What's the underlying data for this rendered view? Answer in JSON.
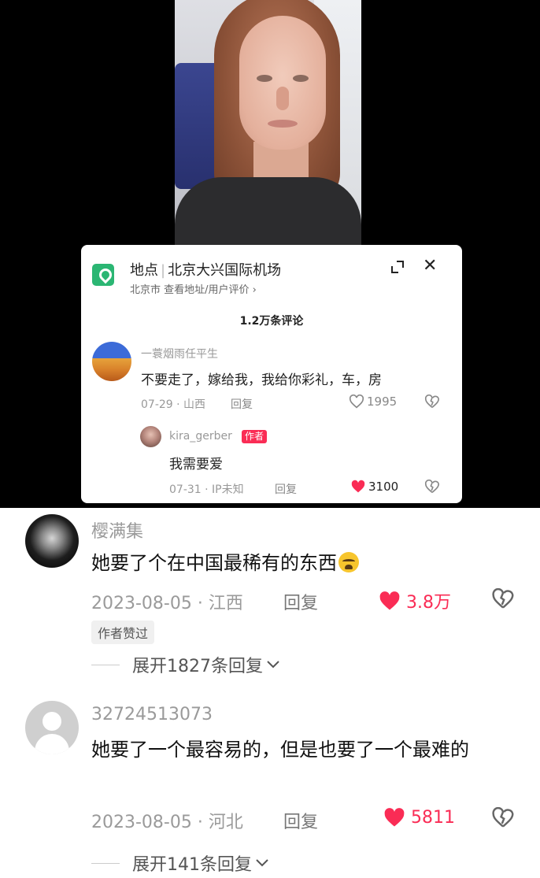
{
  "location_card": {
    "label": "地点",
    "place": "北京大兴国际机场",
    "sub": "北京市 查看地址/用户评价 ›",
    "comment_count": "1.2万条评论",
    "comments": [
      {
        "user": "一蓑烟雨任平生",
        "text": "不要走了，嫁给我，我给你彩礼，车，房",
        "meta": "07-29 · 山西",
        "reply": "回复",
        "likes": "1995"
      },
      {
        "user": "kira_gerber",
        "tag": "作者",
        "text": "我需要爱",
        "meta": "07-31 · IP未知",
        "reply": "回复",
        "likes": "3100"
      }
    ]
  },
  "comments": [
    {
      "user": "樱满集",
      "text": "她要了个在中国最稀有的东西",
      "emoji": "loudly-crying-face",
      "meta": "2023-08-05 · 江西",
      "reply": "回复",
      "likes": "3.8万",
      "badge": "作者赞过",
      "expand": "展开1827条回复"
    },
    {
      "user": "32724513073",
      "text": "她要了一个最容易的，但是也要了一个最难的",
      "meta": "2023-08-05 · 河北",
      "reply": "回复",
      "likes": "5811",
      "expand": "展开141条回复"
    }
  ],
  "colors": {
    "accent_red": "#fa2c55",
    "map_green": "#2bb673",
    "muted": "#9a9a9a"
  }
}
